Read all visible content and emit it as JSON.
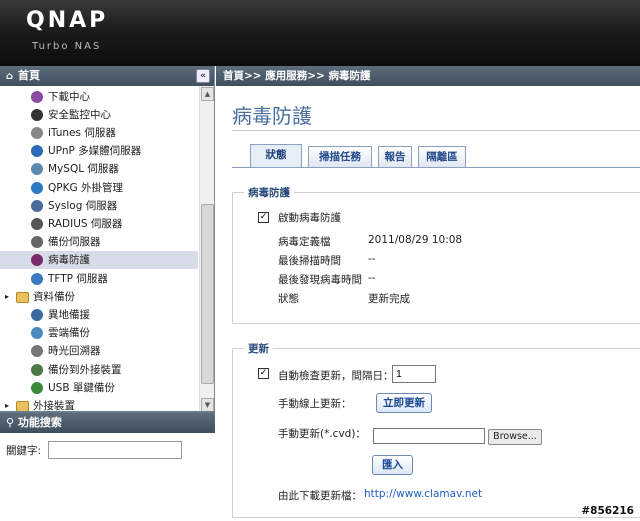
{
  "brand": {
    "logo": "QNAP",
    "sub": "Turbo NAS"
  },
  "tree": {
    "header": "首頁",
    "collapse": "«",
    "items": [
      {
        "label": "下載中心",
        "icon": "download-center-icon",
        "color": "#8a4aa0"
      },
      {
        "label": "安全監控中心",
        "icon": "surveillance-icon",
        "color": "#333333"
      },
      {
        "label": "iTunes 伺服器",
        "icon": "itunes-icon",
        "color": "#888888"
      },
      {
        "label": "UPnP 多媒體伺服器",
        "icon": "upnp-icon",
        "color": "#2b6db8"
      },
      {
        "label": "MySQL 伺服器",
        "icon": "mysql-icon",
        "color": "#5a8ab0"
      },
      {
        "label": "QPKG 外掛管理",
        "icon": "qpkg-icon",
        "color": "#2b7ac0"
      },
      {
        "label": "Syslog 伺服器",
        "icon": "syslog-icon",
        "color": "#4a6a9a"
      },
      {
        "label": "RADIUS 伺服器",
        "icon": "radius-icon",
        "color": "#555555"
      },
      {
        "label": "備份伺服器",
        "icon": "backup-server-icon",
        "color": "#666666"
      },
      {
        "label": "病毒防護",
        "icon": "antivirus-icon",
        "color": "#7a2a6a"
      },
      {
        "label": "TFTP 伺服器",
        "icon": "tftp-icon",
        "color": "#3a7ac0"
      },
      {
        "label": "資料備份",
        "icon": "folder-icon",
        "color": "#e8c060"
      },
      {
        "label": "異地備援",
        "icon": "remote-replication-icon",
        "color": "#3a6aa0"
      },
      {
        "label": "雲端備份",
        "icon": "cloud-backup-icon",
        "color": "#4a8ac0"
      },
      {
        "label": "時光回溯器",
        "icon": "time-machine-icon",
        "color": "#777777"
      },
      {
        "label": "備份到外接裝置",
        "icon": "external-backup-icon",
        "color": "#4a7a4a"
      },
      {
        "label": "USB 單鍵備份",
        "icon": "usb-backup-icon",
        "color": "#3a8a3a"
      },
      {
        "label": "外接裝置",
        "icon": "folder-icon",
        "color": "#e8c060"
      }
    ]
  },
  "search": {
    "header": "功能搜索",
    "keyword_label": "關鍵字:",
    "keyword_value": ""
  },
  "breadcrumb": "首頁>> 應用服務>> 病毒防護",
  "main": {
    "title": "病毒防護",
    "tabs": [
      "狀態",
      "掃描任務",
      "報告",
      "隔離區"
    ],
    "status": {
      "legend": "病毒防護",
      "enable_label": "啟動病毒防護",
      "enable_checked": "✓",
      "rows": [
        {
          "label": "病毒定義檔",
          "value": "2011/08/29 10:08"
        },
        {
          "label": "最後掃描時間",
          "value": "--"
        },
        {
          "label": "最後發現病毒時間",
          "value": "--"
        },
        {
          "label": "狀態",
          "value": "更新完成"
        }
      ]
    },
    "update": {
      "legend": "更新",
      "auto_label": "自動檢查更新，間隔日：",
      "auto_checked": "✓",
      "interval_value": "1",
      "online_label": "手動線上更新：",
      "online_button": "立即更新",
      "manual_label": "手動更新(*.cvd)：",
      "browse_button": "Browse...",
      "import_button": "匯入",
      "download_label": "由此下載更新檔：",
      "download_link": "http://www.clamav.net"
    }
  },
  "watermark": "#856216"
}
